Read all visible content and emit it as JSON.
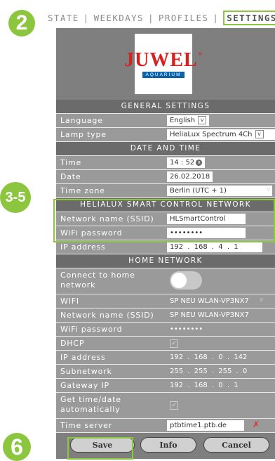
{
  "badges": {
    "step_a": "2",
    "step_b": "3-5",
    "step_c": "6"
  },
  "nav": {
    "items": [
      "STATE",
      "WEEKDAYS",
      "PROFILES",
      "SETTINGS"
    ],
    "separator": "|",
    "active": "SETTINGS"
  },
  "logo": {
    "brand": "JUWEL",
    "reg": "®",
    "sub": "AQUARIUM"
  },
  "sections": {
    "general": "GENERAL SETTINGS",
    "datetime": "DATE AND TIME",
    "helialux": "HELIALUX SMART CONTROL NETWORK",
    "home": "HOME NETWORK"
  },
  "general": {
    "language_label": "Language",
    "language_value": "English",
    "lamp_label": "Lamp type",
    "lamp_value": "HeliaLux Spectrum 4Ch"
  },
  "datetime": {
    "time_label": "Time",
    "time_value": "14 : 52",
    "date_label": "Date",
    "date_value": "26.02.2018",
    "timezone_label": "Time zone",
    "timezone_value": "Berlin (UTC + 1)"
  },
  "helialux": {
    "ssid_label": "Network name (SSID)",
    "ssid_value": "HLSmartControl",
    "wifi_pw_label": "WiFi password",
    "wifi_pw_value": "••••••••",
    "ip_label": "IP address",
    "ip": [
      "192",
      "168",
      "4",
      "1"
    ]
  },
  "home": {
    "connect_label": "Connect to home network",
    "wifi_label": "WIFI",
    "wifi_value": "SP NEU WLAN-VP3NX7",
    "ssid_label": "Network name (SSID)",
    "ssid_value": "SP NEU WLAN-VP3NX7",
    "wifi_pw_label": "WiFi password",
    "wifi_pw_value": "••••••••",
    "dhcp_label": "DHCP",
    "ip_label": "IP address",
    "ip": [
      "192",
      "168",
      "0",
      "142"
    ],
    "subnet_label": "Subnetwork",
    "subnet": [
      "255",
      "255",
      "255",
      "0"
    ],
    "gateway_label": "Gateway IP",
    "gateway": [
      "192",
      "168",
      "0",
      "1"
    ],
    "auto_time_label": "Get time/date automatically",
    "time_server_label": "Time server",
    "time_server_value": "ptbtime1.ptb.de"
  },
  "buttons": {
    "save": "Save",
    "info": "Info",
    "cancel": "Cancel"
  },
  "colors": {
    "accent": "#8cc63f",
    "panel": "#7f7f7f",
    "header": "#6b6b6b",
    "error": "#e52b2b",
    "brand_red": "#d8201e",
    "brand_blue": "#0a62a9"
  }
}
